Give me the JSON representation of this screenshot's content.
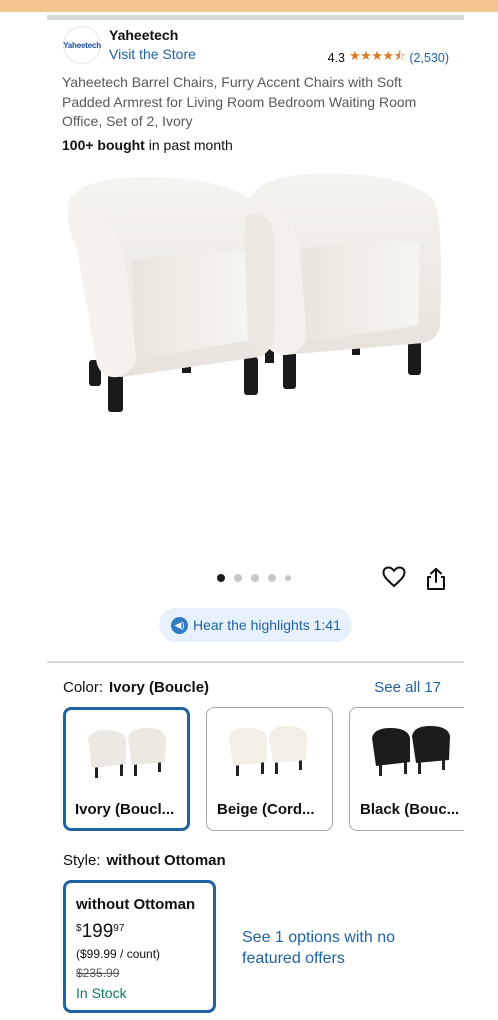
{
  "brand": {
    "logo_text": "Yaheetech",
    "name": "Yaheetech",
    "visit_store": "Visit the Store",
    "rating_value": "4.3",
    "stars": "★★★★⯪",
    "rating_count": "(2,530)"
  },
  "product": {
    "title": "Yaheetech Barrel Chairs, Furry Accent Chairs with Soft Padded Armrest for Living Room Bedroom Waiting Room Office, Set of 2, Ivory",
    "bought_bold": "100+ bought",
    "bought_rest": " in past month",
    "image_icon": "ivory-barrel-chairs-photo"
  },
  "gallery": {
    "dot_count": 5,
    "active_index": 0,
    "heart_icon": "heart-icon",
    "share_icon": "share-icon"
  },
  "highlights": {
    "label": "Hear the highlights 1:41",
    "icon": "audio-icon"
  },
  "color": {
    "label": "Color:",
    "value": "Ivory (Boucle)",
    "see_all": "See all 17",
    "options": [
      {
        "label": "Ivory (Boucl...",
        "swatch_color": "#ece8e2",
        "selected": true
      },
      {
        "label": "Beige (Cord...",
        "swatch_color": "#f3efe6",
        "selected": false
      },
      {
        "label": "Black (Bouc...",
        "swatch_color": "#1c1c1c",
        "selected": false
      }
    ]
  },
  "style": {
    "label": "Style:",
    "value": "without Ottoman",
    "card": {
      "title": "without Ottoman",
      "price_symbol": "$",
      "price_whole": "199",
      "price_fraction": "97",
      "per_unit": "($99.99 / count)",
      "list_price": "$235.99",
      "stock": "In Stock"
    },
    "see_options": "See 1 options with no featured offers"
  },
  "colors": {
    "link": "#2162a1",
    "star": "#de7921",
    "in_stock": "#067d62",
    "selected_border": "#2162a1"
  }
}
